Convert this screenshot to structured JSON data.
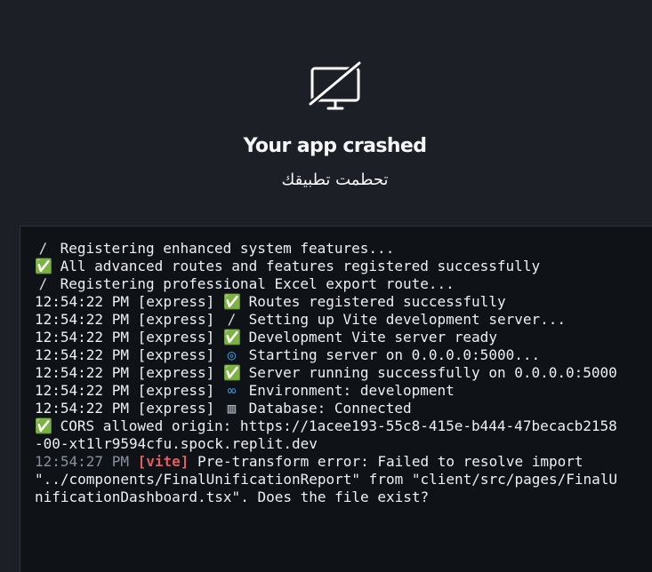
{
  "crash": {
    "icon": "monitor-off-icon",
    "title": "Your app crashed",
    "subtitle": "تحطمت تطبيقك"
  },
  "console": {
    "lines": [
      {
        "icon": "tools-icon",
        "text": "Registering enhanced system features..."
      },
      {
        "icon": "check-icon",
        "text": "All advanced routes and features registered successfully"
      },
      {
        "icon": "tools-icon",
        "text": "Registering professional Excel export route..."
      },
      {
        "time": "12:54:22 PM",
        "source": "[express]",
        "icon": "check-icon",
        "text": "Routes registered successfully"
      },
      {
        "time": "12:54:22 PM",
        "source": "[express]",
        "icon": "tools-icon",
        "text": "Setting up Vite development server..."
      },
      {
        "time": "12:54:22 PM",
        "source": "[express]",
        "icon": "check-icon",
        "text": "Development Vite server ready"
      },
      {
        "time": "12:54:22 PM",
        "source": "[express]",
        "icon": "globe-icon",
        "text": "Starting server on 0.0.0.0:5000..."
      },
      {
        "time": "12:54:22 PM",
        "source": "[express]",
        "icon": "check-icon",
        "text": "Server running successfully on 0.0.0.0:5000"
      },
      {
        "time": "12:54:22 PM",
        "source": "[express]",
        "icon": "link-icon",
        "text": "Environment: development"
      },
      {
        "time": "12:54:22 PM",
        "source": "[express]",
        "icon": "chart-icon",
        "text": "Database: Connected"
      },
      {
        "icon": "check-icon",
        "text": "CORS allowed origin: https://1acee193-55c8-415e-b444-47becacb2158-00-xt1lr9594cfu.spock.replit.dev"
      },
      {
        "time": "12:54:27 PM",
        "source": "[vite]",
        "text": "Pre-transform error: Failed to resolve import \"../components/FinalUnificationReport\" from \"client/src/pages/FinalUnificationDashboard.tsx\". Does the file exist?"
      }
    ]
  },
  "colors": {
    "background": "#1c1f26",
    "console_background": "#0f1217",
    "vite_tag": "#e35d5d",
    "success": "#35c35a"
  }
}
